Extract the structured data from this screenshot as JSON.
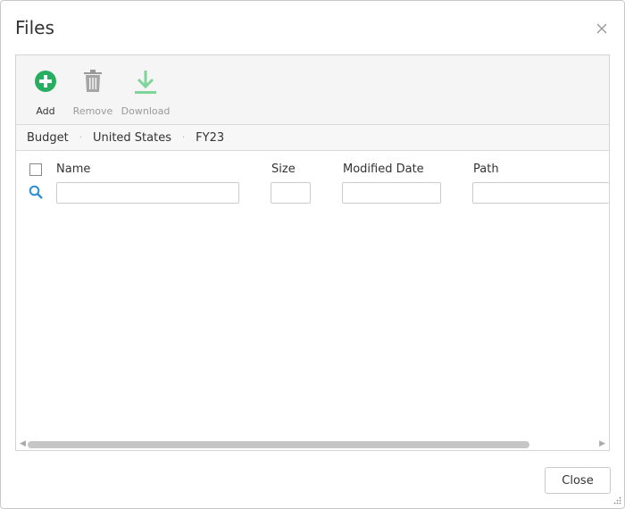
{
  "dialog": {
    "title": "Files",
    "close_icon": "close-icon",
    "toolbar": {
      "add_label": "Add",
      "remove_label": "Remove",
      "download_label": "Download",
      "add_icon": "plus-circle-icon",
      "remove_icon": "trash-icon",
      "download_icon": "download-icon",
      "add_color": "#27ae60",
      "download_color": "#7fd49a"
    },
    "breadcrumb": [
      "Budget",
      "United States",
      "FY23"
    ],
    "grid": {
      "columns": {
        "name": "Name",
        "size": "Size",
        "modified": "Modified Date",
        "path": "Path"
      },
      "filters": {
        "name": "",
        "size": "",
        "modified": "",
        "path": ""
      },
      "rows": []
    },
    "close_button": "Close"
  }
}
